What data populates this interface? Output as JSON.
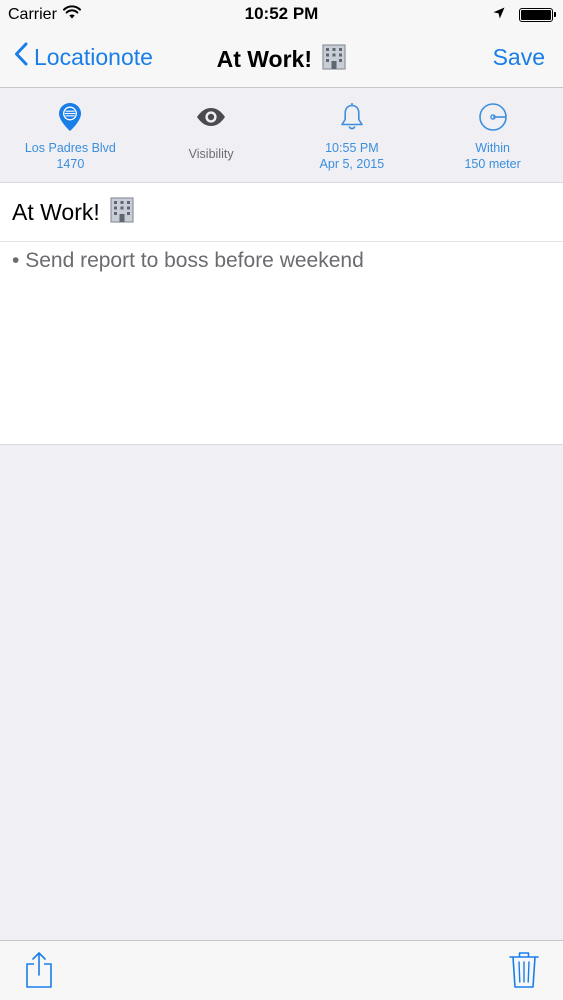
{
  "status_bar": {
    "carrier": "Carrier",
    "time": "10:52 PM",
    "battery_level": 1.0
  },
  "nav": {
    "back_label": "Locationote",
    "title": "At Work!",
    "save_label": "Save"
  },
  "info": {
    "location_line1": "Los Padres Blvd",
    "location_line2": "1470",
    "visibility_label": "Visibility",
    "reminder_time": "10:55 PM",
    "reminder_date": "Apr 5, 2015",
    "radius_line1": "Within",
    "radius_line2": "150 meter"
  },
  "note": {
    "title": "At Work!",
    "bullet": "•",
    "body": "Send report to boss before weekend"
  },
  "icons": {
    "wifi": "wifi-icon",
    "location_arrow": "location-arrow-icon",
    "battery": "battery-icon",
    "back": "chevron-left-icon",
    "building": "office-building-emoji",
    "pin": "map-pin-icon",
    "eye": "eye-icon",
    "bell": "bell-icon",
    "radius": "radius-dial-icon",
    "share": "share-icon",
    "trash": "trash-icon"
  },
  "colors": {
    "accent": "#1a7ee8",
    "info_text": "#3b8fde",
    "secondary_text": "#6b6b70",
    "background": "#efeff4"
  }
}
